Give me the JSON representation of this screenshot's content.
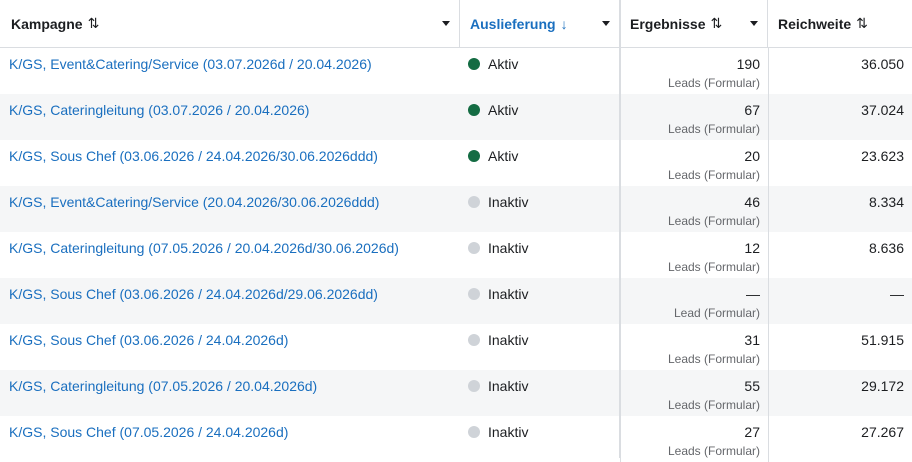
{
  "colors": {
    "link": "#1a6fbf",
    "active": "#146c43",
    "inactive": "#cfd3d8"
  },
  "header": {
    "campaign": "Kampagne",
    "delivery": "Auslieferung",
    "results": "Ergebnisse",
    "reach": "Reichweite",
    "sort_both": "⇅",
    "sort_down": "↓"
  },
  "rows": [
    {
      "name": "K/GS, Event&Catering/Service (03.07.2026d / 20.04.2026)",
      "status": "Aktiv",
      "active": true,
      "results": "190",
      "results_label": "Leads (Formular)",
      "reach": "36.050"
    },
    {
      "name": "K/GS, Cateringleitung (03.07.2026 / 20.04.2026)",
      "status": "Aktiv",
      "active": true,
      "results": "67",
      "results_label": "Leads (Formular)",
      "reach": "37.024"
    },
    {
      "name": "K/GS, Sous Chef (03.06.2026 / 24.04.2026/30.06.2026ddd)",
      "status": "Aktiv",
      "active": true,
      "results": "20",
      "results_label": "Leads (Formular)",
      "reach": "23.623"
    },
    {
      "name": "K/GS, Event&Catering/Service (20.04.2026/30.06.2026ddd)",
      "status": "Inaktiv",
      "active": false,
      "results": "46",
      "results_label": "Leads (Formular)",
      "reach": "8.334"
    },
    {
      "name": "K/GS, Cateringleitung (07.05.2026 / 20.04.2026d/30.06.2026d)",
      "status": "Inaktiv",
      "active": false,
      "results": "12",
      "results_label": "Leads (Formular)",
      "reach": "8.636"
    },
    {
      "name": "K/GS, Sous Chef (03.06.2026 / 24.04.2026d/29.06.2026dd)",
      "status": "Inaktiv",
      "active": false,
      "results": "—",
      "results_label": "Lead (Formular)",
      "reach": "—"
    },
    {
      "name": "K/GS, Sous Chef (03.06.2026 / 24.04.2026d)",
      "status": "Inaktiv",
      "active": false,
      "results": "31",
      "results_label": "Leads (Formular)",
      "reach": "51.915"
    },
    {
      "name": "K/GS, Cateringleitung (07.05.2026 / 20.04.2026d)",
      "status": "Inaktiv",
      "active": false,
      "results": "55",
      "results_label": "Leads (Formular)",
      "reach": "29.172"
    },
    {
      "name": "K/GS, Sous Chef (07.05.2026 / 24.04.2026d)",
      "status": "Inaktiv",
      "active": false,
      "results": "27",
      "results_label": "Leads (Formular)",
      "reach": "27.267"
    }
  ]
}
